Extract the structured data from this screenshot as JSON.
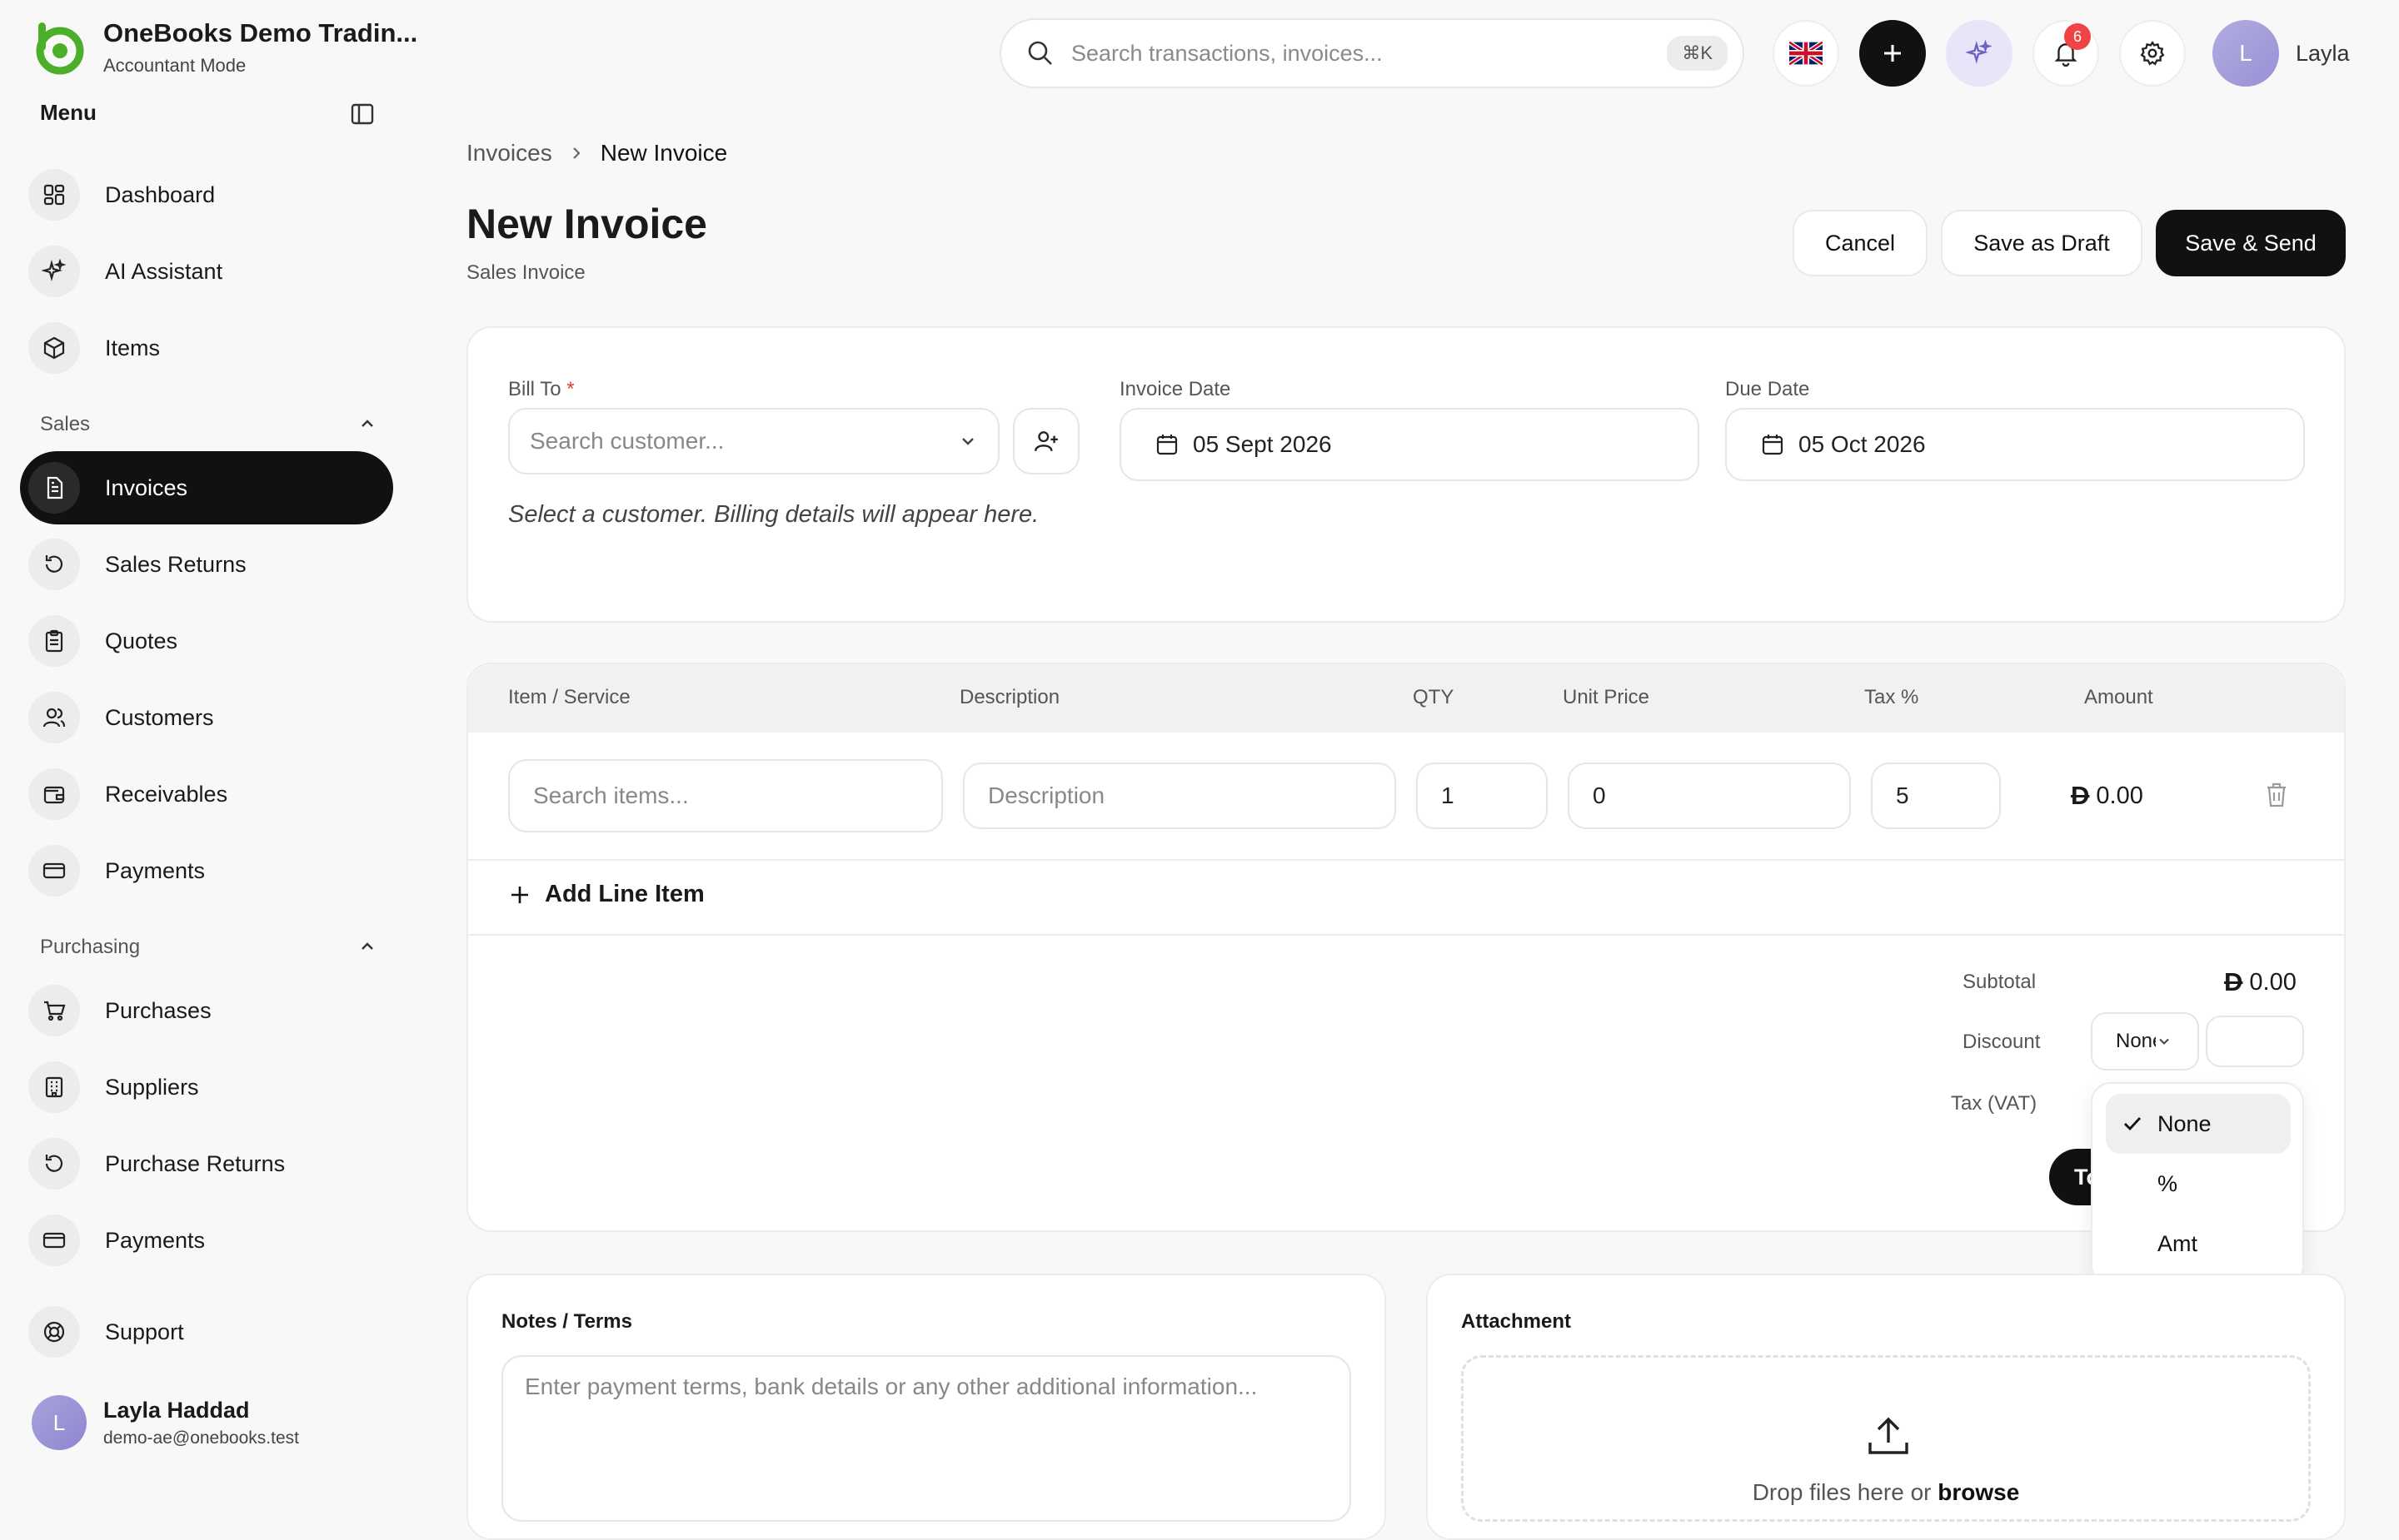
{
  "app": {
    "brand_name": "OneBooks Demo Tradin...",
    "brand_mode": "Accountant Mode",
    "menu_label": "Menu"
  },
  "sidebar": {
    "top_items": [
      {
        "label": "Dashboard",
        "icon": "dashboard-icon"
      },
      {
        "label": "AI Assistant",
        "icon": "sparkles-icon"
      },
      {
        "label": "Items",
        "icon": "box-icon"
      }
    ],
    "sales_label": "Sales",
    "sales_items": [
      {
        "label": "Invoices",
        "icon": "invoice-icon",
        "active": true
      },
      {
        "label": "Sales Returns",
        "icon": "return-icon"
      },
      {
        "label": "Quotes",
        "icon": "clipboard-icon"
      },
      {
        "label": "Customers",
        "icon": "users-icon"
      },
      {
        "label": "Receivables",
        "icon": "wallet-icon"
      },
      {
        "label": "Payments",
        "icon": "card-icon"
      }
    ],
    "purchasing_label": "Purchasing",
    "purchasing_items": [
      {
        "label": "Purchases",
        "icon": "cart-icon"
      },
      {
        "label": "Suppliers",
        "icon": "building-icon"
      },
      {
        "label": "Purchase Returns",
        "icon": "return-icon"
      },
      {
        "label": "Payments",
        "icon": "card-icon"
      }
    ],
    "support_label": "Support",
    "user": {
      "initial": "L",
      "name": "Layla Haddad",
      "email": "demo-ae@onebooks.test"
    }
  },
  "topbar": {
    "search_placeholder": "Search transactions, invoices...",
    "search_shortcut": "⌘K",
    "notification_count": "6",
    "user_initial": "L",
    "user_name": "Layla"
  },
  "breadcrumb": {
    "parent": "Invoices",
    "current": "New Invoice"
  },
  "page": {
    "title": "New Invoice",
    "subtitle": "Sales Invoice"
  },
  "actions": {
    "cancel": "Cancel",
    "draft": "Save as Draft",
    "send": "Save & Send"
  },
  "invoice": {
    "bill_to_label": "Bill To",
    "required_mark": "*",
    "customer_placeholder": "Search customer...",
    "invoice_date_label": "Invoice Date",
    "invoice_date": "05 Sept 2026",
    "due_date_label": "Due Date",
    "due_date": "05 Oct 2026",
    "billing_hint": "Select a customer. Billing details will appear here."
  },
  "items_table": {
    "headers": {
      "item": "Item / Service",
      "description": "Description",
      "qty": "QTY",
      "unit_price": "Unit Price",
      "tax": "Tax %",
      "amount": "Amount"
    },
    "row": {
      "item_placeholder": "Search items...",
      "description_placeholder": "Description",
      "qty": "1",
      "unit_price": "0",
      "tax": "5",
      "currency_symbol": "D",
      "amount": "0.00"
    },
    "add_line_label": "Add Line Item"
  },
  "summary": {
    "subtotal_label": "Subtotal",
    "subtotal_value": "0.00",
    "discount_label": "Discount",
    "discount_selected": "None",
    "tax_label": "Tax (VAT)",
    "total_label": "To"
  },
  "discount_dropdown": {
    "options": [
      "None",
      "%",
      "Amt"
    ],
    "selected_index": 0
  },
  "notes": {
    "title": "Notes / Terms",
    "placeholder": "Enter payment terms, bank details or any other additional information..."
  },
  "attachment": {
    "title": "Attachment",
    "drop_text": "Drop files here or ",
    "browse_text": "browse"
  },
  "colors": {
    "brand_green": "#4caf2a",
    "accent_dark": "#111111",
    "badge_red": "#ef4444",
    "avatar_lavender": "#a7a3dd"
  }
}
